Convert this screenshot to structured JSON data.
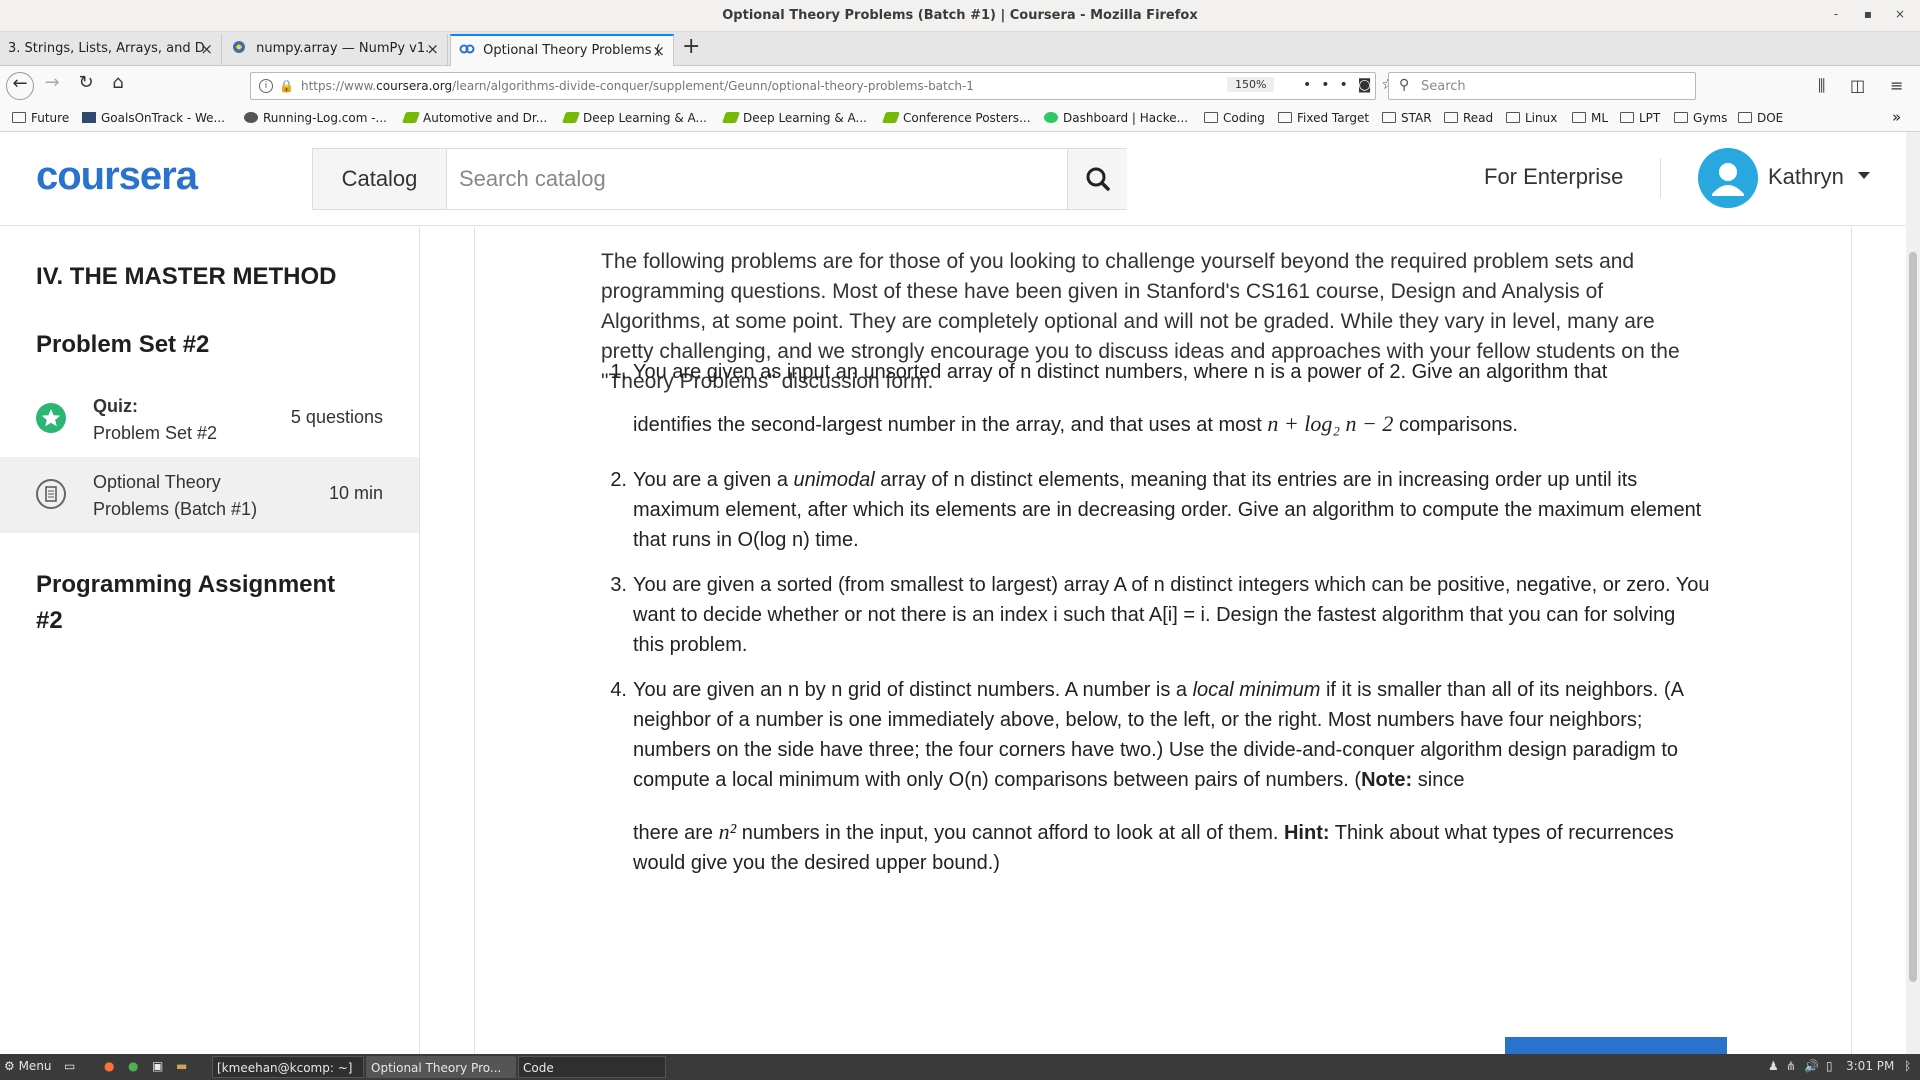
{
  "window": {
    "title": "Optional Theory Problems (Batch #1) | Coursera - Mozilla Firefox",
    "controls": [
      "-",
      "▪",
      "×"
    ]
  },
  "tabs": [
    {
      "label": "3. Strings, Lists, Arrays, and D",
      "active": false
    },
    {
      "label": "numpy.array — NumPy v1.",
      "active": false
    },
    {
      "label": "Optional Theory Problems (",
      "active": true
    }
  ],
  "navbar": {
    "url_prefix": "https://www.",
    "url_domain": "coursera.org",
    "url_path": "/learn/algorithms-divide-conquer/supplement/Geunn/optional-theory-problems-batch-1",
    "zoom": "150%",
    "search_placeholder": "Search"
  },
  "bookmarks": [
    {
      "label": "Future",
      "icon": "folder-icon"
    },
    {
      "label": "GoalsOnTrack - We...",
      "icon": "goalsontrack-icon"
    },
    {
      "label": "Running-Log.com -...",
      "icon": "running-log-icon"
    },
    {
      "label": "Automotive and Dr...",
      "icon": "nvidia-icon"
    },
    {
      "label": "Deep Learning & A...",
      "icon": "nvidia-icon"
    },
    {
      "label": "Deep Learning & A...",
      "icon": "nvidia-icon"
    },
    {
      "label": "Conference Posters...",
      "icon": "nvidia-icon"
    },
    {
      "label": "Dashboard | Hacke...",
      "icon": "hackerrank-icon"
    },
    {
      "label": "Coding",
      "icon": "folder-icon"
    },
    {
      "label": "Fixed Target",
      "icon": "folder-icon"
    },
    {
      "label": "STAR",
      "icon": "folder-icon"
    },
    {
      "label": "Read",
      "icon": "folder-icon"
    },
    {
      "label": "Linux",
      "icon": "folder-icon"
    },
    {
      "label": "ML",
      "icon": "folder-icon"
    },
    {
      "label": "LPT",
      "icon": "folder-icon"
    },
    {
      "label": "Gyms",
      "icon": "folder-icon"
    },
    {
      "label": "DOE",
      "icon": "folder-icon"
    }
  ],
  "header": {
    "logo": "coursera",
    "catalog_label": "Catalog",
    "search_placeholder": "Search catalog",
    "enterprise_label": "For Enterprise",
    "user_name": "Kathryn"
  },
  "sidebar": {
    "section_title": "IV. THE MASTER METHOD",
    "group_title": "Problem Set #2",
    "items": [
      {
        "line1": "Quiz:",
        "line2": "Problem Set #2",
        "meta": "5 questions",
        "icon": "completed-star-icon",
        "selected": false
      },
      {
        "line1": "Optional Theory",
        "line2": "Problems (Batch #1)",
        "meta": "10 min",
        "icon": "reading-icon",
        "selected": true
      }
    ],
    "next_group_title_line1": "Programming Assignment",
    "next_group_title_line2": "#2"
  },
  "content": {
    "intro": "The following problems are for those of you looking to challenge yourself beyond the required problem sets and programming questions. Most of these have been given in Stanford's CS161 course, Design and Analysis of Algorithms, at some point. They are completely optional and will not be graded. While they vary in level, many are pretty challenging, and we strongly encourage you to discuss ideas and approaches with your fellow students on the \"Theory Problems\" discussion form.",
    "p1_num": "1.",
    "p1_a": "You are given as input an unsorted array of n distinct numbers, where n is a power of 2. Give an algorithm that",
    "p1_b": "identifies the second-largest number in the array, and that uses at most",
    "p1_math": "n + log₂ n − 2",
    "p1_c": "comparisons.",
    "p2_num": "2.",
    "p2_a": "You are a given a",
    "p2_em": "unimodal",
    "p2_b": "array of n distinct elements, meaning that its entries are in increasing order up until its maximum element, after which its elements are in decreasing order. Give an algorithm to compute the maximum element that runs in O(log n) time.",
    "p3_num": "3.",
    "p3_text": "You are given a sorted (from smallest to largest) array A of n distinct integers which can be positive, negative, or zero. You want to decide whether or not there is an index i such that A[i] = i. Design the fastest algorithm that you can for solving this problem.",
    "p4_num": "4.",
    "p4_a": "You are given an n by n grid of distinct numbers. A number is a",
    "p4_em": "local minimum",
    "p4_b": "if it is smaller than all of its neighbors. (A neighbor of a number is one immediately above, below, to the left, or the right. Most numbers have four neighbors; numbers on the side have three; the four corners have two.) Use the divide-and-conquer algorithm design paradigm to compute a local minimum with only O(n) comparisons between pairs of numbers. (",
    "p4_note": "Note:",
    "p4_c": "since",
    "p4_d": "there are",
    "p4_math": "n²",
    "p4_e": "numbers in the input, you cannot afford to look at all of them.",
    "p4_hint": "Hint:",
    "p4_f": "Think about what types of recurrences would give you the desired upper bound.)"
  },
  "taskbar": {
    "menu_label": "Menu",
    "windows": [
      {
        "label": "[kmeehan@kcomp: ~]",
        "active": false
      },
      {
        "label": "Optional Theory Pro...",
        "active": true
      },
      {
        "label": "Code",
        "active": false
      }
    ],
    "clock": "3:01 PM"
  },
  "colors": {
    "brand_blue": "#2a73cc",
    "completed_green": "#2bb673",
    "avatar_blue": "#29a8e0"
  }
}
